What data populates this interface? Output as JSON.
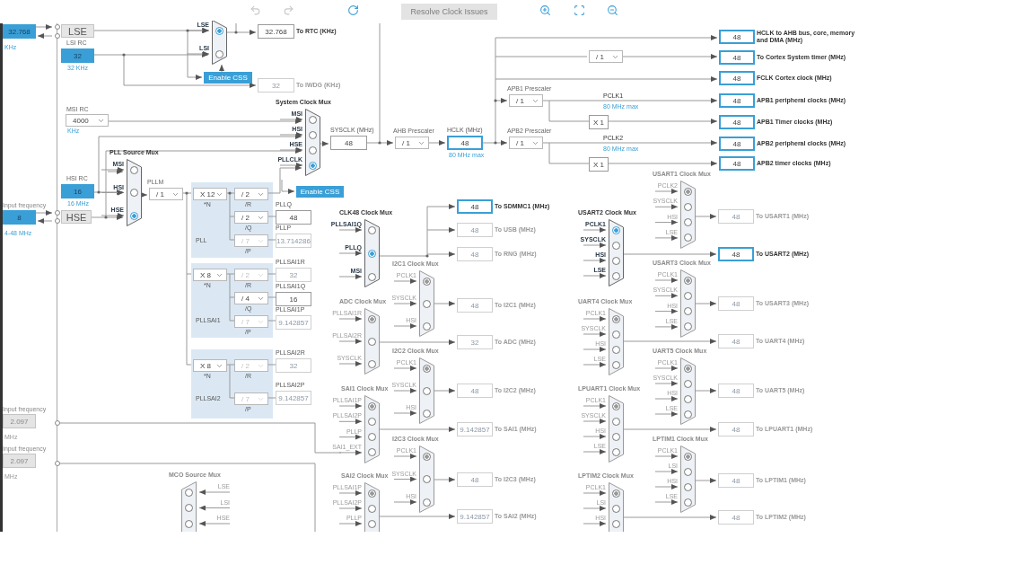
{
  "toolbar": {
    "button": {
      "label": "Resolve Clock Issues",
      "disabled": true
    }
  },
  "left_inputs": [
    {
      "value": "32.768",
      "unit": "KHz",
      "active": true
    },
    {
      "label": "Input frequency",
      "value": "8",
      "unit": "4-48 MHz",
      "active": true
    },
    {
      "label": "Input frequency",
      "value": "2.097",
      "unit": "MHz",
      "active": false
    },
    {
      "label": "Input frequency",
      "value": "2.097",
      "unit": "MHz",
      "active": false
    }
  ],
  "oscillators": [
    {
      "kind": "block",
      "name": "LSE"
    },
    {
      "kind": "rc",
      "name": "LSI RC",
      "value": "32",
      "unit": "32 KHz"
    },
    {
      "kind": "dropdown",
      "name": "MSI RC",
      "value": "4000",
      "unit": "KHz"
    },
    {
      "kind": "rc",
      "name": "HSI RC",
      "value": "16",
      "unit": "16 MHz"
    },
    {
      "kind": "block",
      "name": "HSE"
    }
  ],
  "pll_blocks": [
    {
      "name": "PLL"
    },
    {
      "name": "PLLSAI1"
    },
    {
      "name": "PLLSAI2"
    }
  ],
  "muxes": [
    {
      "kind": "mux",
      "active": true,
      "inputs": [
        {
          "label": "LSE",
          "selected": true
        },
        {
          "label": "LSI",
          "selected": false
        }
      ]
    },
    {
      "kind": "mux",
      "title": "System Clock Mux",
      "active": true,
      "inputs": [
        {
          "label": "MSI",
          "selected": false
        },
        {
          "label": "HSI",
          "selected": false
        },
        {
          "label": "HSE",
          "selected": false
        },
        {
          "label": "PLLCLK",
          "selected": true
        }
      ]
    },
    {
      "kind": "mux",
      "title": "PLL Source Mux",
      "active": true,
      "inputs": [
        {
          "label": "MSI",
          "selected": false
        },
        {
          "label": "HSI",
          "selected": false
        },
        {
          "label": "HSE",
          "selected": true
        }
      ]
    },
    {
      "kind": "mux_reversed",
      "title": "MCO Source Mux",
      "active": false,
      "inputs": [
        {
          "label": "LSE",
          "selected": false
        },
        {
          "label": "LSI",
          "selected": false
        },
        {
          "label": "HSE",
          "selected": false
        }
      ]
    },
    {
      "kind": "mux",
      "title": "CLK48 Clock Mux",
      "active": true,
      "inputs": [
        {
          "label": "PLLSAI1Q",
          "selected": false
        },
        {
          "label": "PLLQ",
          "selected": true
        },
        {
          "label": "MSI",
          "selected": false
        }
      ]
    },
    {
      "kind": "mux",
      "title": "ADC Clock Mux",
      "active": false,
      "inputs": [
        {
          "label": "PLLSAI1R",
          "selected": true
        },
        {
          "label": "PLLSAI2R",
          "selected": false
        },
        {
          "label": "SYSCLK",
          "selected": false
        }
      ]
    },
    {
      "kind": "mux",
      "title": "SAI1 Clock Mux",
      "active": false,
      "inputs": [
        {
          "label": "PLLSAI1P",
          "selected": true
        },
        {
          "label": "PLLSAI2P",
          "selected": false
        },
        {
          "label": "PLLP",
          "selected": false
        },
        {
          "label": "SAI1_EXT",
          "selected": false
        }
      ]
    },
    {
      "kind": "mux",
      "title": "SAI2 Clock Mux",
      "active": false,
      "inputs": [
        {
          "label": "PLLSAI1P",
          "selected": true
        },
        {
          "label": "PLLSAI2P",
          "selected": false
        },
        {
          "label": "PLLP",
          "selected": false
        }
      ]
    },
    {
      "kind": "mux",
      "title": "I2C1 Clock Mux",
      "active": false,
      "inputs": [
        {
          "label": "PCLK1",
          "selected": true
        },
        {
          "label": "SYSCLK",
          "selected": false
        },
        {
          "label": "HSI",
          "selected": false
        }
      ]
    },
    {
      "kind": "mux",
      "title": "I2C2 Clock Mux",
      "active": false,
      "inputs": [
        {
          "label": "PCLK1",
          "selected": true
        },
        {
          "label": "SYSCLK",
          "selected": false
        },
        {
          "label": "HSI",
          "selected": false
        }
      ]
    },
    {
      "kind": "mux",
      "title": "I2C3 Clock Mux",
      "active": false,
      "inputs": [
        {
          "label": "PCLK1",
          "selected": true
        },
        {
          "label": "SYSCLK",
          "selected": false
        },
        {
          "label": "HSI",
          "selected": false
        }
      ]
    },
    {
      "kind": "mux",
      "title": "USART1 Clock Mux",
      "active": false,
      "inputs": [
        {
          "label": "PCLK2",
          "selected": true
        },
        {
          "label": "SYSCLK",
          "selected": false
        },
        {
          "label": "HSI",
          "selected": false
        },
        {
          "label": "LSE",
          "selected": false
        }
      ]
    },
    {
      "kind": "mux",
      "title": "USART2 Clock Mux",
      "active": true,
      "inputs": [
        {
          "label": "PCLK1",
          "selected": true
        },
        {
          "label": "SYSCLK",
          "selected": false
        },
        {
          "label": "HSI",
          "selected": false
        },
        {
          "label": "LSE",
          "selected": false
        }
      ]
    },
    {
      "kind": "mux",
      "title": "USART3 Clock Mux",
      "active": false,
      "inputs": [
        {
          "label": "PCLK1",
          "selected": true
        },
        {
          "label": "SYSCLK",
          "selected": false
        },
        {
          "label": "HSI",
          "selected": false
        },
        {
          "label": "LSE",
          "selected": false
        }
      ]
    },
    {
      "kind": "mux",
      "title": "UART4 Clock Mux",
      "active": false,
      "inputs": [
        {
          "label": "PCLK1",
          "selected": true
        },
        {
          "label": "SYSCLK",
          "selected": false
        },
        {
          "label": "HSI",
          "selected": false
        },
        {
          "label": "LSE",
          "selected": false
        }
      ]
    },
    {
      "kind": "mux",
      "title": "UART5 Clock Mux",
      "active": false,
      "inputs": [
        {
          "label": "PCLK1",
          "selected": true
        },
        {
          "label": "SYSCLK",
          "selected": false
        },
        {
          "label": "HSI",
          "selected": false
        },
        {
          "label": "LSE",
          "selected": false
        }
      ]
    },
    {
      "kind": "mux",
      "title": "LPUART1 Clock Mux",
      "active": false,
      "inputs": [
        {
          "label": "PCLK1",
          "selected": true
        },
        {
          "label": "SYSCLK",
          "selected": false
        },
        {
          "label": "HSI",
          "selected": false
        },
        {
          "label": "LSE",
          "selected": false
        }
      ]
    },
    {
      "kind": "mux",
      "title": "LPTIM1 Clock Mux",
      "active": false,
      "inputs": [
        {
          "label": "PCLK1",
          "selected": true
        },
        {
          "label": "LSI",
          "selected": false
        },
        {
          "label": "HSI",
          "selected": false
        },
        {
          "label": "LSE",
          "selected": false
        }
      ]
    },
    {
      "kind": "mux",
      "title": "LPTIM2 Clock Mux",
      "active": false,
      "inputs": [
        {
          "label": "PCLK1",
          "selected": true
        },
        {
          "label": "LSI",
          "selected": false
        },
        {
          "label": "HSI",
          "selected": false
        }
      ]
    }
  ],
  "dropdowns": [
    {
      "caption": "AHB Prescaler",
      "value": "/ 1",
      "disabled": false
    },
    {
      "caption": "PLLM",
      "value": "/ 1",
      "disabled": false
    },
    {
      "value": "/ 1",
      "disabled": false
    },
    {
      "caption": "APB1 Prescaler",
      "value": "/ 1",
      "disabled": false
    },
    {
      "caption": "APB2 Prescaler",
      "value": "/ 1",
      "disabled": false
    },
    {
      "value": "X 12",
      "sub": "*N",
      "disabled": false
    },
    {
      "value": "/ 2",
      "sub": "/R",
      "disabled": false
    },
    {
      "value": "/ 2",
      "sub": "/Q",
      "disabled": false
    },
    {
      "value": "/ 7",
      "sub": "/P",
      "disabled": true
    },
    {
      "value": "X 8",
      "sub": "*N",
      "disabled": false
    },
    {
      "value": "/ 2",
      "sub": "/R",
      "disabled": true
    },
    {
      "value": "/ 4",
      "sub": "/Q",
      "disabled": false
    },
    {
      "value": "/ 7",
      "sub": "/P",
      "disabled": true
    },
    {
      "value": "X 8",
      "sub": "*N",
      "disabled": false
    },
    {
      "value": "/ 2",
      "sub": "/R",
      "disabled": true
    },
    {
      "value": "/ 7",
      "sub": "/P",
      "disabled": true
    }
  ],
  "value_boxes": [
    {
      "value": "32.768",
      "highlighted": false,
      "disabled": false,
      "label": "To RTC (KHz)"
    },
    {
      "value": "32",
      "highlighted": false,
      "disabled": true,
      "label": "To IWDG (KHz)"
    },
    {
      "caption": "SYSCLK (MHz)",
      "value": "48",
      "highlighted": false,
      "disabled": false
    },
    {
      "caption": "HCLK (MHz)",
      "value": "48",
      "highlighted": true,
      "disabled": false,
      "note": "80 MHz max"
    },
    {
      "value": "48",
      "highlighted": true,
      "disabled": false,
      "label": "HCLK to AHB bus, core, memory and DMA (MHz)"
    },
    {
      "value": "48",
      "highlighted": true,
      "disabled": false,
      "label": "To Cortex System timer (MHz)"
    },
    {
      "value": "48",
      "highlighted": true,
      "disabled": false,
      "label": "FCLK Cortex clock (MHz)"
    },
    {
      "value": "48",
      "highlighted": true,
      "disabled": false,
      "label": "APB1 peripheral clocks (MHz)"
    },
    {
      "value": "48",
      "highlighted": true,
      "disabled": false,
      "label": "APB1 Timer clocks (MHz)"
    },
    {
      "value": "48",
      "highlighted": true,
      "disabled": false,
      "label": "APB2 peripheral clocks (MHz)"
    },
    {
      "value": "48",
      "highlighted": true,
      "disabled": false,
      "label": "APB2 timer clocks (MHz)"
    },
    {
      "value": "X 1",
      "highlighted": false,
      "disabled": false
    },
    {
      "value": "X 1",
      "highlighted": false,
      "disabled": false
    },
    {
      "caption": "PLLQ",
      "value": "48",
      "highlighted": false,
      "disabled": false
    },
    {
      "caption": "PLLP",
      "value": "13.714286",
      "highlighted": false,
      "disabled": true
    },
    {
      "caption": "PLLSAI1R",
      "value": "32",
      "highlighted": false,
      "disabled": true
    },
    {
      "caption": "PLLSAI1Q",
      "value": "16",
      "highlighted": false,
      "disabled": false
    },
    {
      "caption": "PLLSAI1P",
      "value": "9.142857",
      "highlighted": false,
      "disabled": true
    },
    {
      "caption": "PLLSAI2R",
      "value": "32",
      "highlighted": false,
      "disabled": true
    },
    {
      "caption": "PLLSAI2P",
      "value": "9.142857",
      "highlighted": false,
      "disabled": true
    },
    {
      "value": "48",
      "highlighted": true,
      "disabled": false,
      "label": "To SDMMC1 (MHz)"
    },
    {
      "value": "48",
      "highlighted": false,
      "disabled": true,
      "label": "To USB (MHz)"
    },
    {
      "value": "48",
      "highlighted": false,
      "disabled": true,
      "label": "To RNG (MHz)"
    },
    {
      "value": "48",
      "highlighted": false,
      "disabled": true,
      "label": "To I2C1 (MHz)"
    },
    {
      "value": "32",
      "highlighted": false,
      "disabled": true,
      "label": "To ADC (MHz)"
    },
    {
      "value": "48",
      "highlighted": false,
      "disabled": true,
      "label": "To I2C2 (MHz)"
    },
    {
      "value": "9.142857",
      "highlighted": false,
      "disabled": true,
      "label": "To SAI1 (MHz)"
    },
    {
      "value": "48",
      "highlighted": false,
      "disabled": true,
      "label": "To I2C3 (MHz)"
    },
    {
      "value": "9.142857",
      "highlighted": false,
      "disabled": true,
      "label": "To SAI2 (MHz)"
    },
    {
      "value": "48",
      "highlighted": false,
      "disabled": true,
      "label": "To USART1 (MHz)"
    },
    {
      "value": "48",
      "highlighted": true,
      "disabled": false,
      "label": "To USART2 (MHz)"
    },
    {
      "value": "48",
      "highlighted": false,
      "disabled": true,
      "label": "To USART3 (MHz)"
    },
    {
      "value": "48",
      "highlighted": false,
      "disabled": true,
      "label": "To UART4 (MHz)"
    },
    {
      "value": "48",
      "highlighted": false,
      "disabled": true,
      "label": "To UART5 (MHz)"
    },
    {
      "value": "48",
      "highlighted": false,
      "disabled": true,
      "label": "To LPUART1 (MHz)"
    },
    {
      "value": "48",
      "highlighted": false,
      "disabled": true,
      "label": "To LPTIM1 (MHz)"
    },
    {
      "value": "48",
      "highlighted": false,
      "disabled": true,
      "label": "To LPTIM2 (MHz)"
    }
  ],
  "buttons": [
    {
      "label": "Enable CSS"
    },
    {
      "label": "Enable CSS"
    }
  ],
  "texts": [
    {
      "kind": "label",
      "text": "PCLK1"
    },
    {
      "kind": "note",
      "text": "80 MHz max"
    },
    {
      "kind": "label",
      "text": "PCLK2"
    },
    {
      "kind": "note",
      "text": "80 MHz max"
    }
  ]
}
